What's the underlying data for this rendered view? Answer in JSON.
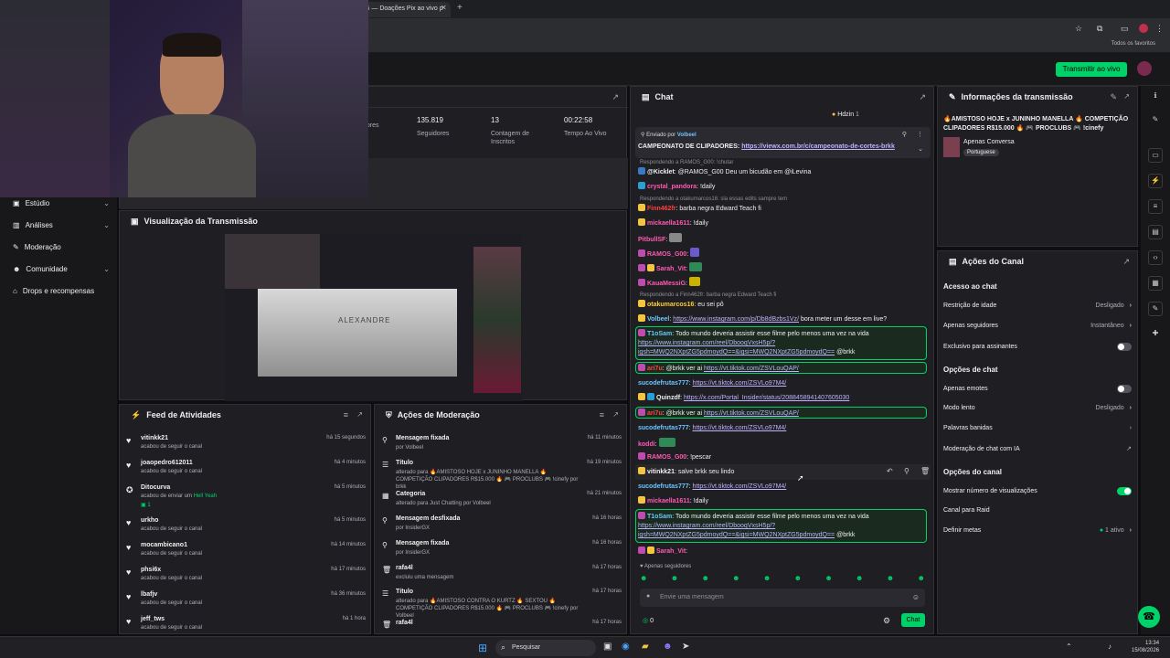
{
  "browser": {
    "tab_title": "G — Doações Pix ao vivo p",
    "bookmarks": "Todos os favoritos"
  },
  "topbar": {
    "live_button": "Transmitir ao vivo"
  },
  "nav": {
    "items": [
      {
        "label": "Estúdio",
        "has_chevron": true
      },
      {
        "label": "Análises",
        "has_chevron": true
      },
      {
        "label": "Moderação",
        "has_chevron": false
      },
      {
        "label": "Comunidade",
        "has_chevron": true
      },
      {
        "label": "Drops e recompensas",
        "has_chevron": false
      }
    ]
  },
  "stats": {
    "items": [
      {
        "value": "",
        "label": "dores"
      },
      {
        "value": "135.819",
        "label": "Seguidores"
      },
      {
        "value": "13",
        "label": "Contagem de Inscritos"
      },
      {
        "value": "00:22:58",
        "label": "Tempo Ao Vivo"
      }
    ]
  },
  "preview": {
    "title": "Visualização da Transmissão",
    "video_caption": "ALEXANDRE"
  },
  "feed": {
    "title": "Feed de Atividades",
    "items": [
      {
        "name": "vitinkk21",
        "desc": "acabou de seguir o canal",
        "time": "há 15 segundos"
      },
      {
        "name": "joaopedro612011",
        "desc": "acabou de seguir o canal",
        "time": "há 4 minutos"
      },
      {
        "name": "Ditocurva",
        "desc": "acabou de enviar um",
        "extra": "Hell Yeah",
        "count": "1",
        "time": "há 5 minutos"
      },
      {
        "name": "urkho",
        "desc": "acabou de seguir o canal",
        "time": "há 5 minutos"
      },
      {
        "name": "mocambicano1",
        "desc": "acabou de seguir o canal",
        "time": "há 14 minutos"
      },
      {
        "name": "phsi6x",
        "desc": "acabou de seguir o canal",
        "time": "há 17 minutos"
      },
      {
        "name": "lbafjv",
        "desc": "acabou de seguir o canal",
        "time": "há 36 minutos"
      },
      {
        "name": "jeff_tws",
        "desc": "acabou de seguir o canal",
        "time": "há 1 hora"
      }
    ]
  },
  "moderation": {
    "title": "Ações de Moderação",
    "items": [
      {
        "name": "Mensagem fixada",
        "desc": "por Volbeel",
        "time": "há 11 minutos"
      },
      {
        "name": "Título",
        "desc": "alterado para 🔥AMISTOSO HOJE x JUNINHO MANELLA 🔥 COMPETIÇÃO CLIPADORES R$15.000 🔥 🎮 PROCLUBS 🎮 !cinefy por brkk",
        "time": "há 19 minutos"
      },
      {
        "name": "Categoria",
        "desc": "alterado para Just Chatting por Volbeel",
        "time": "há 21 minutos"
      },
      {
        "name": "Mensagem desfixada",
        "desc": "por InsiderGX",
        "time": "há 16 horas"
      },
      {
        "name": "Mensagem fixada",
        "desc": "por InsiderGX",
        "time": "há 16 horas"
      },
      {
        "name": "rafa4l",
        "desc": "excluiu uma mensagem",
        "time": "há 17 horas"
      },
      {
        "name": "Título",
        "desc": "alterado para 🔥AMISTOSO CONTRA O KURTZ 🔥 SEXTOU 🔥 COMPETIÇÃO CLIPADORES R$15.000 🔥 🎮 PROCLUBS 🎮 !cinefy por Volbeel",
        "time": "há 17 horas"
      },
      {
        "name": "rafa4l",
        "desc": "",
        "time": "há 17 horas"
      }
    ]
  },
  "chat": {
    "title": "Chat",
    "top_user": "Hdzin",
    "top_count": "1",
    "pinned": {
      "by_label": "Enviado por",
      "by_user": "Volbeel",
      "text": "CAMPEONATO DE CLIPADORES:",
      "link": "https://viewx.com.br/c/campeonato-de-cortes-brkk"
    },
    "lines": [
      {
        "reply": "Respondendo a RAMOS_G00: !chutar"
      },
      {
        "user": "@Kicklet",
        "color": "#efeff1",
        "text": ": @RAMOS_G00 Deu um bicudão em @iLevina"
      },
      {
        "user": "crystal_pandora",
        "color": "#ff5ab4",
        "text": ": !daily"
      },
      {
        "reply": "Respondendo a otakumarcos16: sla essas edits sampre tem"
      },
      {
        "user": "Finn462fr",
        "color": "#ff4040",
        "text": ": barba negra Edward Teach fi"
      },
      {
        "user": "mickaella1611",
        "color": "#ff5ab4",
        "text": ": !daily"
      },
      {
        "user": "PitbullSF",
        "color": "#ff5ab4",
        "text": ":"
      },
      {
        "user": "RAMOS_G00",
        "color": "#ff5ab4",
        "text": ":"
      },
      {
        "user": "Sarah_Vit",
        "color": "#ff5ab4",
        "text": ":"
      },
      {
        "user": "KauaMessiG",
        "color": "#ff5ab4",
        "text": ":"
      },
      {
        "reply": "Respondendo a Finn462fr: barba negra Edward Teach fi"
      },
      {
        "user": "otakumarcos16",
        "color": "#ffcc33",
        "text": ": eu sei pô"
      },
      {
        "user": "Volbeel",
        "color": "#6cc4ff",
        "text": ":",
        "link": "https://www.instagram.com/p/Db8dBzbs1Vz/",
        "after": " bora meter um desse em live?"
      }
    ],
    "hl1": {
      "user": "T1oSam",
      "text": ": Todo mundo deveria assistir esse filme pelo menos uma vez na vida",
      "link1": "https://www.instagram.com/reel/DbooqVxsH5p/?",
      "link2": "igsh=MWQ2NXptZG5pdmoydQ==&igsi=MWQ2NXptZG5pdmoydQ==",
      "after": " @brkk"
    },
    "line_ar": {
      "user": "ari7u",
      "text": ": @brkk ver ai",
      "link": "https://vt.tiktok.com/ZSVLouQAP/"
    },
    "line_suco1": {
      "user": "sucodefrutas777",
      "text": ":",
      "link": "https://vt.tiktok.com/ZSVLo97M4/"
    },
    "line_quinz": {
      "user": "Quinzdf",
      "text": ":",
      "link": "https://x.com/Portal_Insider/status/2088458941407605030"
    },
    "line_ar2": {
      "user": "ari7u",
      "text": ": @brkk ver ai",
      "link": "https://vt.tiktok.com/ZSVLouQAP/"
    },
    "line_suco2": {
      "user": "sucodefrutas777",
      "text": ":",
      "link": "https://vt.tiktok.com/ZSVLo97M4/"
    },
    "line_kodd": {
      "user": "koddi",
      "text": ":"
    },
    "line_ramos": {
      "user": "RAMOS_G00",
      "text": ": !pescar"
    },
    "line_viti": {
      "user": "vitinkk21",
      "text": ": salve brkk seu lindo"
    },
    "line_suco3": {
      "user": "sucodefrutas777",
      "text": ":",
      "link": "https://vt.tiktok.com/ZSVLo97M4/"
    },
    "line_mick": {
      "user": "mickaella1611",
      "text": ": !daily"
    },
    "hl2": {
      "user": "T1oSam",
      "text": ": Todo mundo deveria assistir esse filme pelo menos uma vez na vida",
      "link1": "https://www.instagram.com/reel/DbooqVxsH5p/?",
      "link2": "igsh=MWQ2NXptZG5pdmoydQ==&igsi=MWQ2NXptZG5pdmoydQ==",
      "after": " @brkk"
    },
    "line_sarah": {
      "user": "Sarah_Vit",
      "text": ":"
    },
    "followers_only": "Apenas seguidores",
    "input_placeholder": "Envie uma mensagem",
    "viewer_count": "0",
    "send_button": "Chat"
  },
  "info": {
    "title": "Informações da transmissão",
    "stream_title": "🔥AMISTOSO HOJE x JUNINHO MANELLA 🔥 COMPETIÇÃO CLIPADORES R$15.000 🔥 🎮 PROCLUBS 🎮 !cinefy",
    "category": "Apenas Conversa",
    "language": "Portuguese"
  },
  "channel": {
    "title": "Ações do Canal",
    "sec1": "Acesso ao chat",
    "age": "Restrição de idade",
    "age_val": "Desligado",
    "followers": "Apenas seguidores",
    "followers_val": "Instantâneo",
    "subs": "Exclusivo para assinantes",
    "sec2": "Opções de chat",
    "emotes": "Apenas emotes",
    "slow": "Modo lento",
    "slow_val": "Desligado",
    "banned": "Palavras banidas",
    "ai": "Moderação de chat com IA",
    "sec3": "Opções do canal",
    "views": "Mostrar número de visualizações",
    "raid": "Canal para Raid",
    "goals": "Definir metas",
    "goals_val": "1 ativo"
  },
  "taskbar": {
    "search": "Pesquisar",
    "time": "13:34",
    "date": "15/08/2026"
  },
  "colors": {
    "accent": "#00d26a",
    "panel": "#1f1f23",
    "bg": "#0e0e10"
  }
}
